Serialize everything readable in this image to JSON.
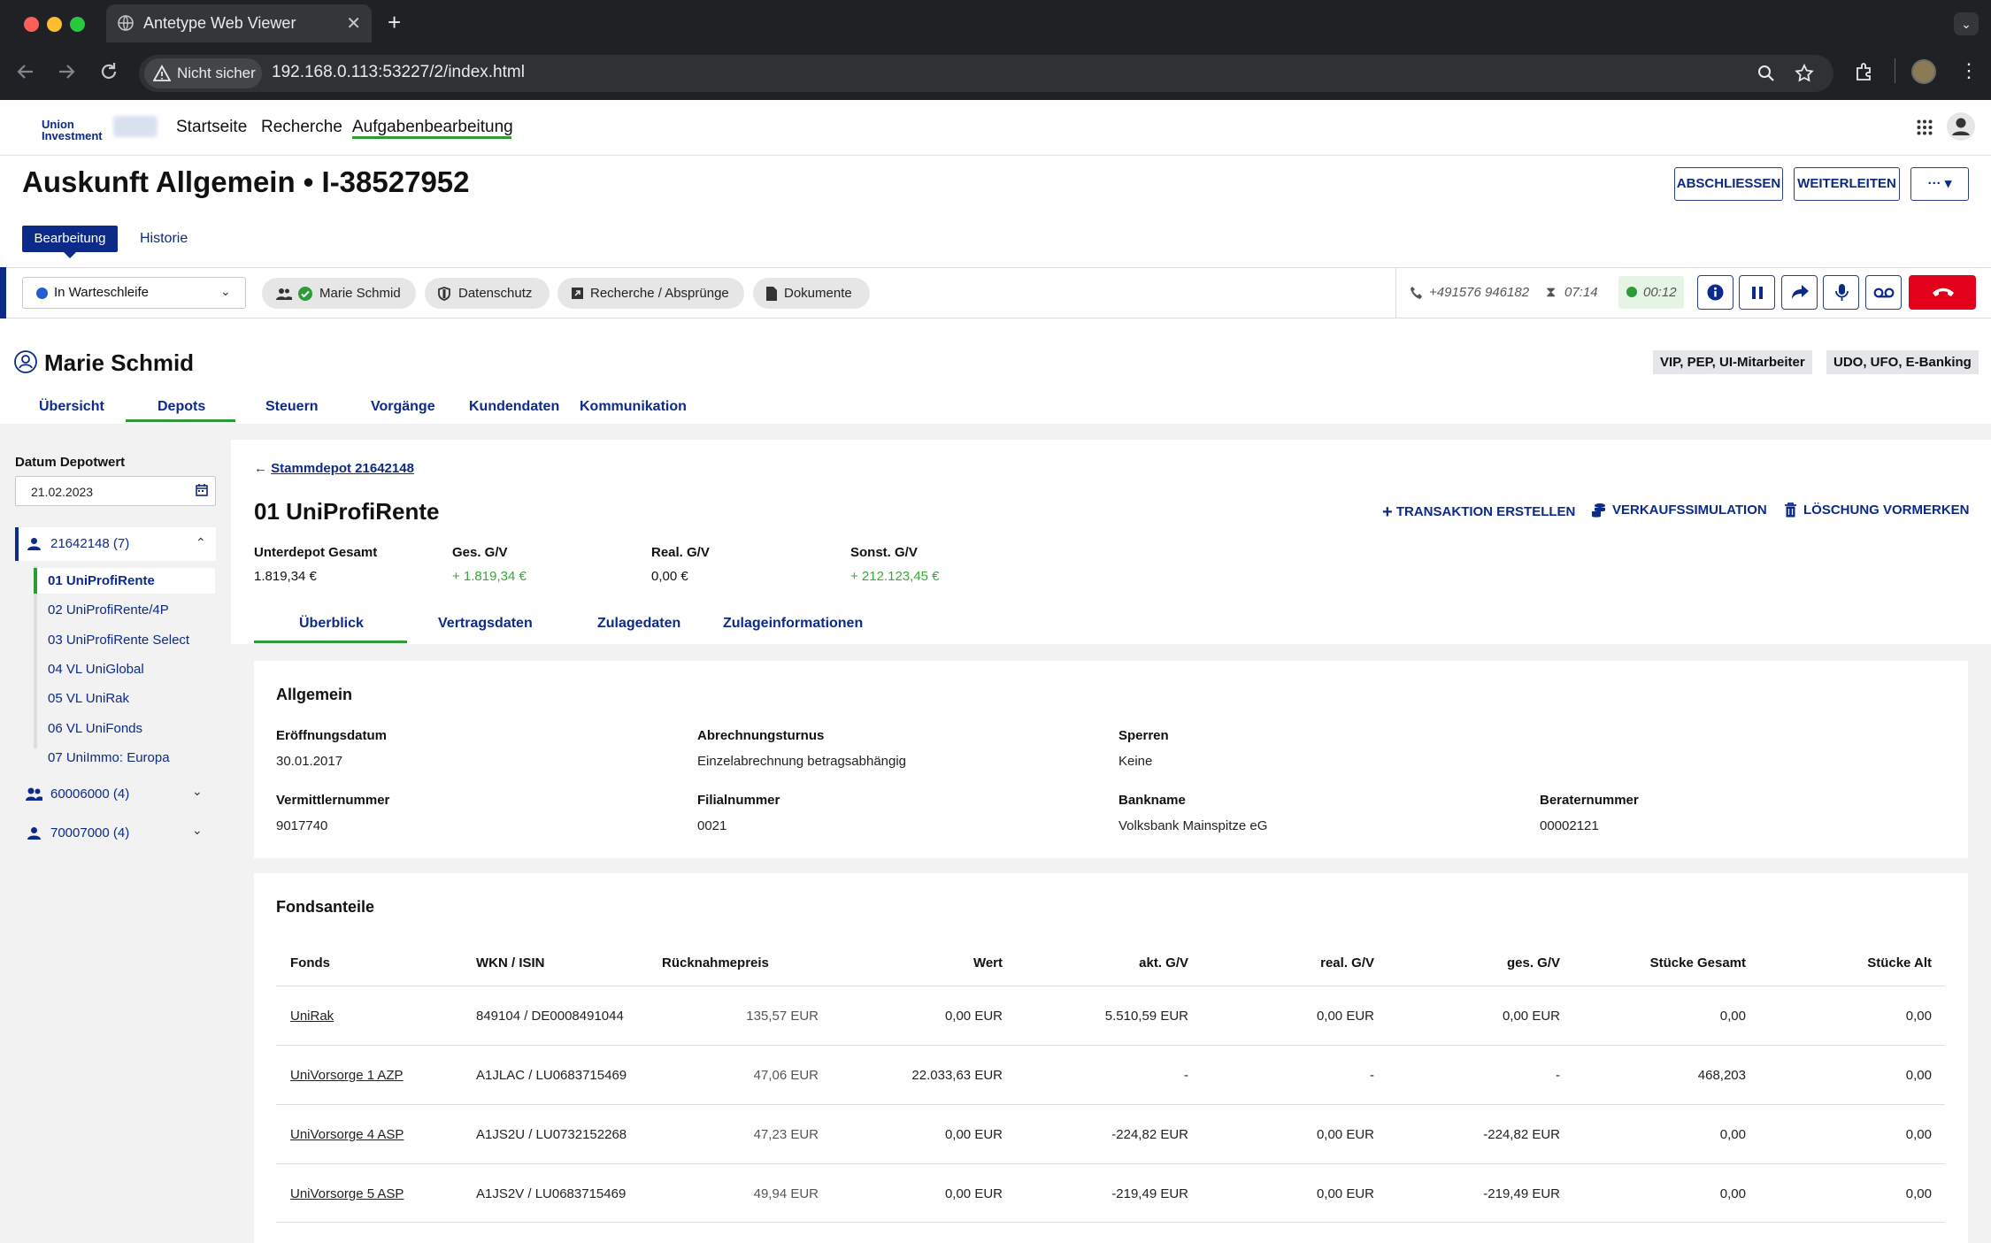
{
  "browser": {
    "tab_title": "Antetype Web Viewer",
    "security_label": "Nicht sicher",
    "url": "192.168.0.113:53227/2/index.html"
  },
  "app": {
    "brand_line1": "Union",
    "brand_line2": "Investment",
    "nav": [
      "Startseite",
      "Recherche",
      "Aufgabenbearbeitung"
    ],
    "nav_active": "Aufgabenbearbeitung"
  },
  "task": {
    "title": "Auskunft Allgemein • I-38527952",
    "buttons": {
      "finish": "ABSCHLIESSEN",
      "forward": "WEITERLEITEN",
      "more": "···"
    },
    "tabs": {
      "edit": "Bearbeitung",
      "history": "Historie"
    }
  },
  "toolbar": {
    "status": "In Warteschleife",
    "pills": [
      "Marie Schmid",
      "Datenschutz",
      "Recherche / Absprünge",
      "Dokumente"
    ],
    "phone": "+491576 946182",
    "wait_time": "07:14",
    "call_time": "00:12"
  },
  "customer": {
    "name": "Marie Schmid",
    "badges": [
      "VIP, PEP, UI-Mitarbeiter",
      "UDO, UFO, E-Banking"
    ],
    "tabs": [
      "Übersicht",
      "Depots",
      "Steuern",
      "Vorgänge",
      "Kundendaten",
      "Kommunikation"
    ],
    "active_tab": "Depots"
  },
  "sidebar": {
    "date_label": "Datum Depotwert",
    "date_value": "21.02.2023",
    "groups": [
      {
        "label": "21642148 (7)",
        "expanded": true,
        "items": [
          "01 UniProfiRente",
          "02 UniProfiRente/4P",
          "03 UniProfiRente Select",
          "04 VL UniGlobal",
          "05 VL UniRak",
          "06 VL UniFonds",
          "07 UniImmo: Europa"
        ]
      },
      {
        "label": "60006000 (4)",
        "expanded": false
      },
      {
        "label": "70007000 (4)",
        "expanded": false
      }
    ],
    "active_item": "01 UniProfiRente"
  },
  "depot": {
    "back_link": "Stammdepot 21642148",
    "title": "01 UniProfiRente",
    "actions": [
      "TRANSAKTION ERSTELLEN",
      "VERKAUFSSIMULATION",
      "LÖSCHUNG VORMERKEN"
    ],
    "kpis": [
      {
        "label": "Unterdepot Gesamt",
        "value": "1.819,34 €",
        "positive": false
      },
      {
        "label": "Ges. G/V",
        "value": "+ 1.819,34 €",
        "positive": true
      },
      {
        "label": "Real. G/V",
        "value": "0,00 €",
        "positive": false
      },
      {
        "label": "Sonst. G/V",
        "value": "+ 212.123,45 €",
        "positive": true
      }
    ],
    "tabs": [
      "Überblick",
      "Vertragsdaten",
      "Zulagedaten",
      "Zulageinformationen"
    ],
    "active_tab": "Überblick"
  },
  "general": {
    "title": "Allgemein",
    "fields": [
      {
        "label": "Eröffnungsdatum",
        "value": "30.01.2017"
      },
      {
        "label": "Abrechnungsturnus",
        "value": "Einzelabrechnung betragsabhängig"
      },
      {
        "label": "Sperren",
        "value": "Keine"
      },
      {
        "label": "Vermittlernummer",
        "value": "9017740"
      },
      {
        "label": "Filialnummer",
        "value": "0021"
      },
      {
        "label": "Bankname",
        "value": "Volksbank Mainspitze eG"
      },
      {
        "label": "Beraternummer",
        "value": "00002121"
      }
    ]
  },
  "funds": {
    "title": "Fondsanteile",
    "columns": [
      "Fonds",
      "WKN / ISIN",
      "Rücknahmepreis",
      "Wert",
      "akt. G/V",
      "real. G/V",
      "ges. G/V",
      "Stücke Gesamt",
      "Stücke Alt"
    ],
    "rows": [
      [
        "UniRak",
        "849104 / DE0008491044",
        "135,57 EUR",
        "0,00 EUR",
        "5.510,59 EUR",
        "0,00 EUR",
        "0,00 EUR",
        "0,00",
        "0,00"
      ],
      [
        "UniVorsorge 1 AZP",
        "A1JLAC / LU0683715469",
        "47,06 EUR",
        "22.033,63 EUR",
        "-",
        "-",
        "-",
        "468,203",
        "0,00"
      ],
      [
        "UniVorsorge 4 ASP",
        "A1JS2U / LU0732152268",
        "47,23 EUR",
        "0,00 EUR",
        "-224,82 EUR",
        "0,00 EUR",
        "-224,82 EUR",
        "0,00",
        "0,00"
      ],
      [
        "UniVorsorge 5 ASP",
        "A1JS2V / LU0683715469",
        "49,94 EUR",
        "0,00 EUR",
        "-219,49 EUR",
        "0,00 EUR",
        "-219,49 EUR",
        "0,00",
        "0,00"
      ]
    ]
  },
  "colors": {
    "primary": "#0c2a87",
    "accent_green": "#2c9c38",
    "positive": "#3aa63a",
    "hangup": "#e3001b"
  }
}
